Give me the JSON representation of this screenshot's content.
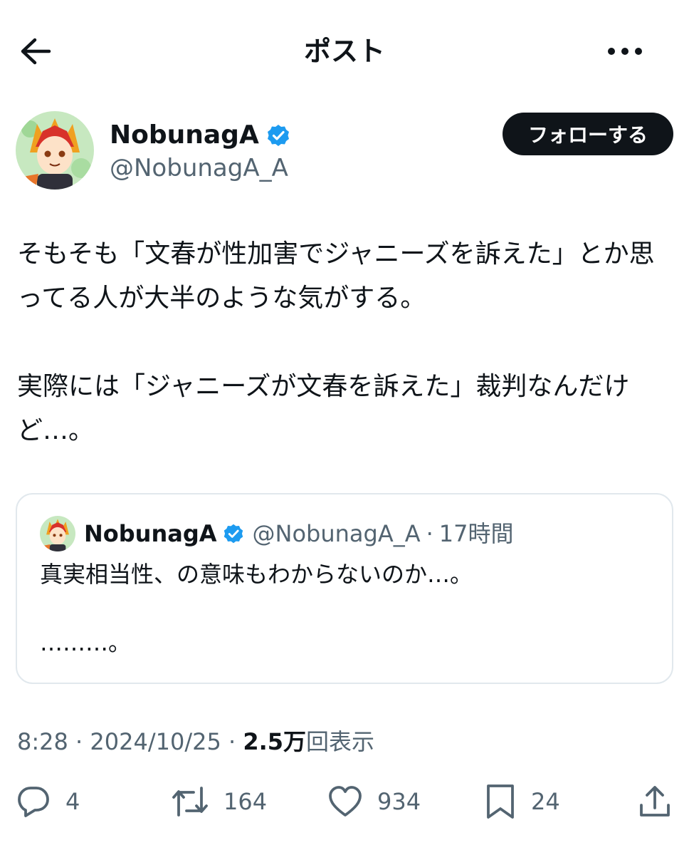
{
  "header": {
    "title": "ポスト",
    "back_icon": "arrow-left-icon",
    "more_icon": "more-horizontal-icon"
  },
  "author": {
    "display_name": "NobunagA",
    "handle": "@NobunagA_A",
    "verified_icon": "verified-badge-icon",
    "follow_label": "フォローする"
  },
  "post": {
    "text": "そもそも「文春が性加害でジャニーズを訴えた」とか思ってる人が大半のような気がする。\n\n実際には「ジャニーズが文春を訴えた」裁判なんだけど…。"
  },
  "quote": {
    "display_name": "NobunagA",
    "handle": "@NobunagA_A",
    "separator": "·",
    "time": "17時間",
    "text": "真実相当性、の意味もわからないのか…。\n\n………。"
  },
  "meta": {
    "time": "8:28",
    "sep1": " · ",
    "date": "2024/10/25",
    "sep2": " · ",
    "views_count": "2.5万",
    "views_label": "回表示"
  },
  "actions": {
    "replies": "4",
    "reposts": "164",
    "likes": "934",
    "bookmarks": "24"
  },
  "colors": {
    "text": "#0f1419",
    "secondary": "#536471",
    "verified": "#1d9bf0",
    "border": "#e1e8ed",
    "follow_bg": "#0f1419"
  }
}
